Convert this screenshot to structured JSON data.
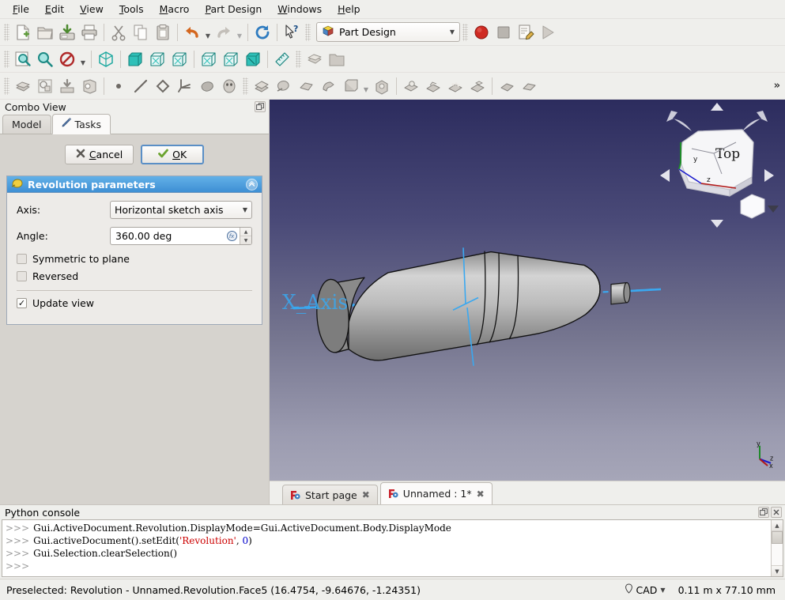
{
  "menu": {
    "items": [
      {
        "label": "File",
        "mnemonic": "F"
      },
      {
        "label": "Edit",
        "mnemonic": "E"
      },
      {
        "label": "View",
        "mnemonic": "V"
      },
      {
        "label": "Tools",
        "mnemonic": "T"
      },
      {
        "label": "Macro",
        "mnemonic": "M"
      },
      {
        "label": "Part Design",
        "mnemonic": "P"
      },
      {
        "label": "Windows",
        "mnemonic": "W"
      },
      {
        "label": "Help",
        "mnemonic": "H"
      }
    ]
  },
  "toolbar_file": {
    "icons": [
      "new-document-icon",
      "open-folder-icon",
      "save-icon",
      "print-icon",
      "cut-icon",
      "copy-icon",
      "paste-icon",
      "undo-icon",
      "redo-icon",
      "refresh-icon",
      "whats-this-icon"
    ]
  },
  "workbench": {
    "label": "Part Design",
    "icon": "workbench-icon",
    "caret": "▼"
  },
  "toolbar_macro": {
    "icons": [
      "macro-record-icon",
      "macro-stop-icon",
      "macro-edit-icon",
      "macro-execute-icon"
    ],
    "record_color": "#cc2222"
  },
  "toolbar_view": {
    "icons": [
      "fit-all-icon",
      "zoom-icon",
      "draw-style-icon",
      "axonometric-view-icon",
      "front-view-icon",
      "top-view-icon",
      "right-view-icon",
      "rear-view-icon",
      "bottom-view-icon",
      "left-view-icon",
      "measure-icon",
      "workbench-part-icon",
      "folder-icon"
    ],
    "accent_color": "#1fa9a0"
  },
  "toolbar_partdesign": {
    "overflow_label": "»"
  },
  "combo_view": {
    "title": "Combo View",
    "float_icon": "float-panel-icon",
    "tabs": [
      {
        "label": "Model",
        "icon": "model-icon",
        "active": false
      },
      {
        "label": "Tasks",
        "icon": "tasks-pencil-icon",
        "active": true
      }
    ],
    "buttons": {
      "cancel": "Cancel",
      "cancel_mnemonic": "C",
      "cancel_icon": "cancel-x-icon",
      "ok": "OK",
      "ok_mnemonic": "O",
      "ok_icon": "ok-check-icon"
    },
    "panel": {
      "title": "Revolution parameters",
      "icon": "revolution-icon",
      "collapse_icon": "chevron-up-icon",
      "fields": [
        {
          "label": "Axis:",
          "value": "Horizontal sketch axis",
          "type": "select"
        },
        {
          "label": "Angle:",
          "value": "360.00 deg",
          "type": "spinbox",
          "expr_icon": "expression-icon"
        }
      ],
      "checkboxes": [
        {
          "label": "Symmetric to plane",
          "checked": false
        },
        {
          "label": "Reversed",
          "checked": false
        },
        {
          "label": "Update view",
          "checked": true
        }
      ]
    }
  },
  "viewport": {
    "axis_label": "X_Axis",
    "navcube": {
      "face_label": "Top",
      "axis_x": "x",
      "axis_y": "y",
      "axis_z": "z",
      "arrow_up": "▲",
      "arrow_down": "▼",
      "arrow_left": "◀",
      "arrow_right": "▶",
      "menu_caret": "▼"
    },
    "corner_axes": {
      "x": "x",
      "y": "y",
      "z": "z"
    },
    "colors": {
      "bg_top": "#2c2c5e",
      "bg_bottom": "#a6a6b8",
      "model": "#a3a3a3",
      "axis_line": "#3aa8f0"
    }
  },
  "view_tabs": [
    {
      "label": "Start page",
      "active": false,
      "close": "✖"
    },
    {
      "label": "Unnamed : 1*",
      "active": true,
      "close": "✖"
    }
  ],
  "python_console": {
    "title": "Python console",
    "float_icon": "float-panel-icon",
    "close_icon": "close-panel-icon",
    "prompt": ">>>",
    "lines": [
      {
        "parts": [
          {
            "t": "Gui.ActiveDocument.Revolution.DisplayMode=Gui.ActiveDocument.Body.DisplayMode",
            "k": "plain"
          }
        ]
      },
      {
        "parts": [
          {
            "t": "Gui.activeDocument().setEdit(",
            "k": "plain"
          },
          {
            "t": "'Revolution'",
            "k": "str"
          },
          {
            "t": ", ",
            "k": "plain"
          },
          {
            "t": "0",
            "k": "num"
          },
          {
            "t": ")",
            "k": "plain"
          }
        ]
      },
      {
        "parts": [
          {
            "t": "Gui.Selection.clearSelection()",
            "k": "plain"
          }
        ]
      },
      {
        "parts": []
      }
    ],
    "scroll": {
      "up": "▲",
      "down": "▼"
    }
  },
  "statusbar": {
    "message": "Preselected: Revolution - Unnamed.Revolution.Face5 (16.4754, -9.64676, -1.24351)",
    "nav_icon": "navigation-icon",
    "nav_label": "CAD",
    "nav_caret": "▼",
    "dimensions": "0.11 m x 77.10 mm"
  }
}
